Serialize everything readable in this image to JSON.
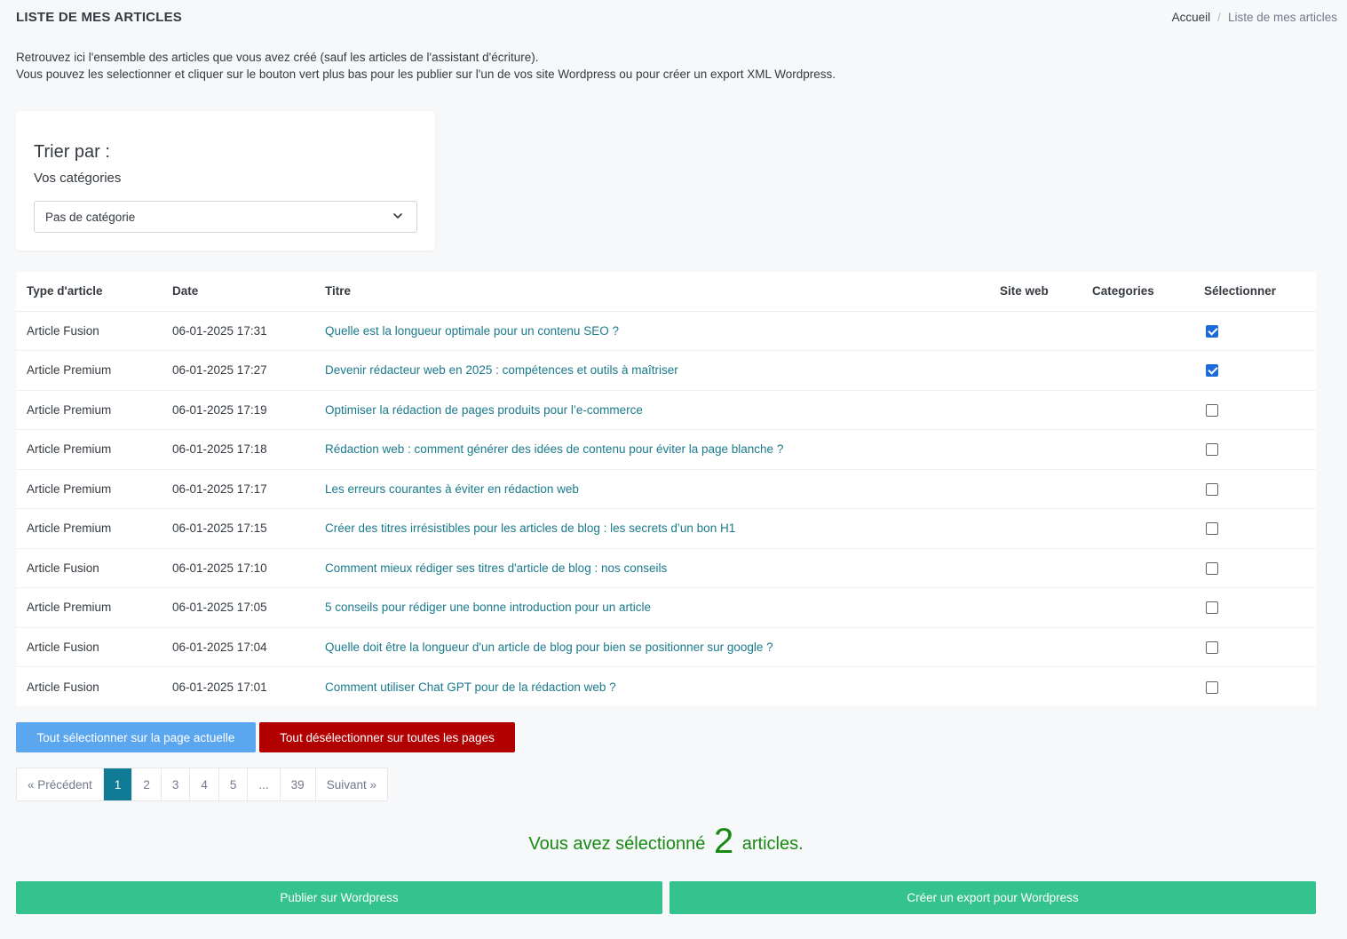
{
  "header": {
    "title": "LISTE DE MES ARTICLES",
    "breadcrumb": {
      "home": "Accueil",
      "separator": "/",
      "current": "Liste de mes articles"
    }
  },
  "intro": {
    "line1": "Retrouvez ici l'ensemble des articles que vous avez créé (sauf les articles de l'assistant d'écriture).",
    "line2": "Vous pouvez les selectionner et cliquer sur le bouton vert plus bas pour les publier sur l'un de vos site Wordpress ou pour créer un export XML Wordpress."
  },
  "filter": {
    "title": "Trier par :",
    "subtitle": "Vos catégories",
    "selected": "Pas de catégorie"
  },
  "table": {
    "columns": [
      "Type d'article",
      "Date",
      "Titre",
      "Site web",
      "Categories",
      "Sélectionner"
    ],
    "rows": [
      {
        "type": "Article Fusion",
        "date": "06-01-2025 17:31",
        "title": "Quelle est la longueur optimale pour un contenu SEO ?",
        "site": "",
        "categories": "",
        "selected": true
      },
      {
        "type": "Article Premium",
        "date": "06-01-2025 17:27",
        "title": "Devenir rédacteur web en 2025 : compétences et outils à maîtriser",
        "site": "",
        "categories": "",
        "selected": true
      },
      {
        "type": "Article Premium",
        "date": "06-01-2025 17:19",
        "title": "Optimiser la rédaction de pages produits pour l’e-commerce",
        "site": "",
        "categories": "",
        "selected": false
      },
      {
        "type": "Article Premium",
        "date": "06-01-2025 17:18",
        "title": "Rédaction web : comment générer des idées de contenu pour éviter la page blanche ?",
        "site": "",
        "categories": "",
        "selected": false
      },
      {
        "type": "Article Premium",
        "date": "06-01-2025 17:17",
        "title": "Les erreurs courantes à éviter en rédaction web",
        "site": "",
        "categories": "",
        "selected": false
      },
      {
        "type": "Article Premium",
        "date": "06-01-2025 17:15",
        "title": "Créer des titres irrésistibles pour les articles de blog : les secrets d’un bon H1",
        "site": "",
        "categories": "",
        "selected": false
      },
      {
        "type": "Article Fusion",
        "date": "06-01-2025 17:10",
        "title": "Comment mieux rédiger ses titres d'article de blog : nos conseils",
        "site": "",
        "categories": "",
        "selected": false
      },
      {
        "type": "Article Premium",
        "date": "06-01-2025 17:05",
        "title": "5 conseils pour rédiger une bonne introduction pour un article",
        "site": "",
        "categories": "",
        "selected": false
      },
      {
        "type": "Article Fusion",
        "date": "06-01-2025 17:04",
        "title": "Quelle doit être la longueur d'un article de blog pour bien se positionner sur google ?",
        "site": "",
        "categories": "",
        "selected": false
      },
      {
        "type": "Article Fusion",
        "date": "06-01-2025 17:01",
        "title": "Comment utiliser Chat GPT pour de la rédaction web ?",
        "site": "",
        "categories": "",
        "selected": false
      }
    ]
  },
  "actions": {
    "select_all": "Tout sélectionner sur la page actuelle",
    "deselect_all": "Tout désélectionner sur toutes les pages"
  },
  "pagination": {
    "prev": "« Précédent",
    "pages": [
      "1",
      "2",
      "3",
      "4",
      "5",
      "...",
      "39"
    ],
    "current": "1",
    "next": "Suivant »"
  },
  "selection": {
    "prefix": "Vous avez sélectionné",
    "count": "2",
    "suffix": "articles."
  },
  "footer": {
    "publish": "Publier sur Wordpress",
    "export": "Créer un export pour Wordpress"
  },
  "colors": {
    "link": "#1a7a8c",
    "select_all_btn": "#5aa7f0",
    "deselect_all_btn": "#b20000",
    "primary_green": "#34c38f",
    "active_page": "#0f7b95",
    "selection_text": "#178a12",
    "checkbox_checked": "#1c6bd6"
  }
}
